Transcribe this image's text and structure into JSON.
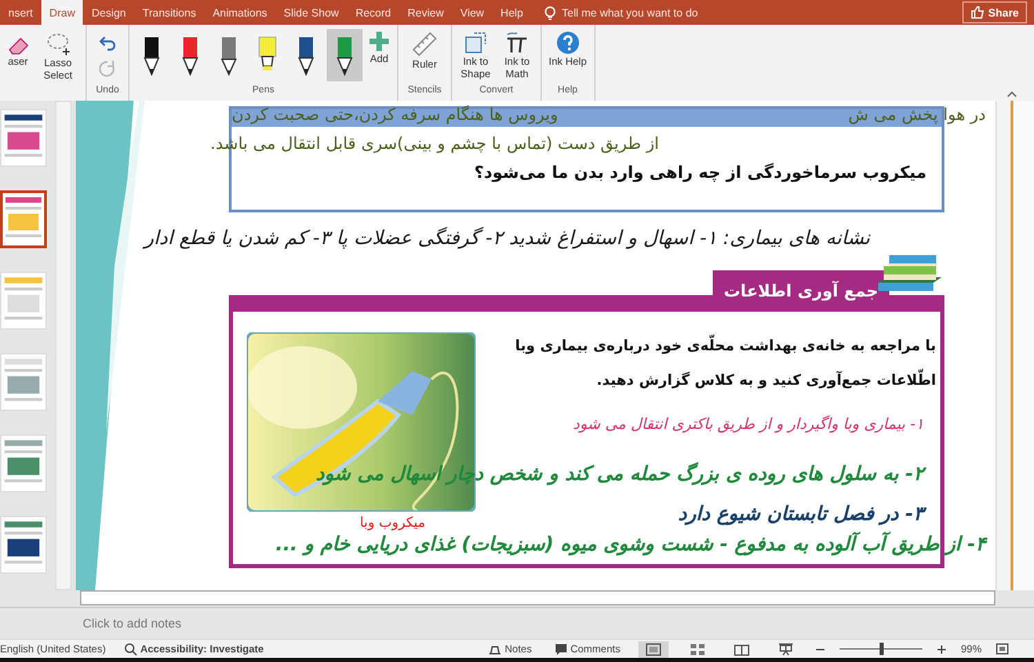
{
  "ribbon": {
    "tabs": [
      {
        "label": "nsert",
        "selected": false
      },
      {
        "label": "Draw",
        "selected": true
      },
      {
        "label": "Design",
        "selected": false
      },
      {
        "label": "Transitions",
        "selected": false
      },
      {
        "label": "Animations",
        "selected": false
      },
      {
        "label": "Slide Show",
        "selected": false
      },
      {
        "label": "Record",
        "selected": false
      },
      {
        "label": "Review",
        "selected": false
      },
      {
        "label": "View",
        "selected": false
      },
      {
        "label": "Help",
        "selected": false
      }
    ],
    "tell_me": "Tell me what you want to do",
    "share": "Share",
    "groups": [
      {
        "items": [
          {
            "kind": "eraser",
            "label": "aser"
          },
          {
            "kind": "lasso",
            "label": "Lasso Select"
          }
        ]
      },
      {
        "label": "Undo",
        "items": [
          {
            "kind": "undo",
            "disabled": false
          },
          {
            "kind": "redo",
            "disabled": true
          }
        ]
      },
      {
        "label": "Pens",
        "items": [
          {
            "kind": "pen",
            "color": "#111111",
            "selected": false
          },
          {
            "kind": "pen",
            "color": "#e8262b",
            "selected": false
          },
          {
            "kind": "pencil",
            "color": "#7a7a7a",
            "selected": false
          },
          {
            "kind": "highlighter",
            "color": "#f5ec3a",
            "selected": false
          },
          {
            "kind": "pen",
            "color": "#1f4e8c",
            "selected": false
          },
          {
            "kind": "pen",
            "color": "#1e9a45",
            "selected": true
          },
          {
            "kind": "add",
            "label": "Add"
          }
        ]
      },
      {
        "label": "Stencils",
        "items": [
          {
            "kind": "ruler",
            "label": "Ruler"
          }
        ]
      },
      {
        "label": "Convert",
        "items": [
          {
            "kind": "shape",
            "label": "Ink to Shape"
          },
          {
            "kind": "math",
            "label": "Ink to Math"
          }
        ]
      },
      {
        "label": "Help",
        "items": [
          {
            "kind": "help",
            "label": "Ink Help"
          }
        ]
      }
    ]
  },
  "thumbnails": [
    {
      "selected": false
    },
    {
      "selected": true
    },
    {
      "selected": false
    },
    {
      "selected": false
    },
    {
      "selected": false
    },
    {
      "selected": false
    }
  ],
  "slide": {
    "question_box": {
      "lines": [
        "در هوا پخش می ش",
        "ویروس ها هنگام سرفه کردن،حتی صحبت کردن",
        "از طریق دست (تماس با چشم و بینی)سری قابل انتقال می باشد.",
        "میکروب سرماخوردگی از چه راهی وارد بدن ما می‌شود؟"
      ]
    },
    "activity": {
      "title": "جمع آوری اطلاعات",
      "lines": [
        "با مراجعه به خانه‌ی بهداشت محلّه‌ی خود درباره‌ی بیماری وبا",
        "اطّلاعات جمع‌آوری کنید و به کلاس گزارش دهید."
      ]
    },
    "ink": [
      {
        "text": "نشانه های بیماری: ۱- اسهال و استفراغ شدید  ۲- گرفتگی عضلات پا   ۳- کم شدن یا قطع ادار",
        "color": "#1a1a1a"
      },
      {
        "text": "۱- بیماری وبا واگیردار و از طریق باکتری انتقال می شود",
        "color": "#d6336c"
      },
      {
        "text": "۲- به سلول های روده ی بزرگ حمله می کند و شخص دچار اسهال می شود",
        "color": "#1f8a3c"
      },
      {
        "text": "۳- در فصل تابستان شیوع دارد",
        "color": "#18406b"
      },
      {
        "text": "۴- از طریق آب آلوده به مدفوع - شست وشوی میوه (سبزیجات) غذای دریایی خام و ...",
        "color": "#1f8a3c"
      },
      {
        "text": "میکروب وبا",
        "color": "#e02020"
      }
    ]
  },
  "notes": {
    "placeholder": "Click to add notes"
  },
  "status_bar": {
    "language": "English (United States)",
    "accessibility": "Accessibility: Investigate",
    "notes": "Notes",
    "comments": "Comments",
    "views": [
      {
        "selected": true
      },
      {
        "selected": false
      },
      {
        "selected": false
      },
      {
        "selected": false
      }
    ],
    "zoom": {
      "level": 0.5,
      "reading": "99%"
    }
  }
}
